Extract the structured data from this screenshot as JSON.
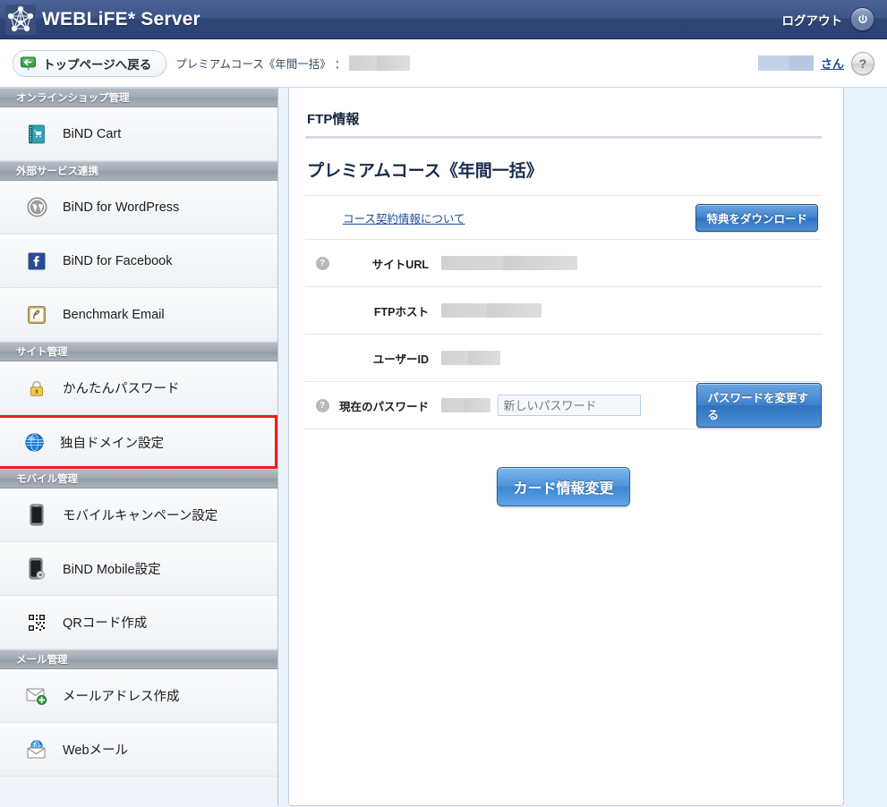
{
  "header": {
    "logo_icon": "network-nodes-logo",
    "title": "WEBLiFE* Server",
    "logout_label": "ログアウト",
    "power_icon": "power-icon"
  },
  "toolbar": {
    "back_icon": "back-arrow-sign-icon",
    "back_label": "トップページへ戻る",
    "breadcrumb_course": "プレミアムコース《年間一括》",
    "breadcrumb_separator": "：",
    "breadcrumb_value_redacted": "",
    "user_name_redacted": "",
    "user_suffix": "さん",
    "help_label": "?"
  },
  "sidebar": {
    "groups": [
      {
        "title": "オンラインショップ管理",
        "items": [
          {
            "label": "BiND Cart",
            "icon": "cart-book-icon",
            "selected": false
          }
        ]
      },
      {
        "title": "外部サービス連携",
        "items": [
          {
            "label": "BiND for WordPress",
            "icon": "wordpress-icon",
            "selected": false
          },
          {
            "label": "BiND for Facebook",
            "icon": "facebook-icon",
            "selected": false
          },
          {
            "label": "Benchmark Email",
            "icon": "benchmark-email-icon",
            "selected": false
          }
        ]
      },
      {
        "title": "サイト管理",
        "items": [
          {
            "label": "かんたんパスワード",
            "icon": "lock-icon",
            "selected": false
          },
          {
            "label": "独自ドメイン設定",
            "icon": "globe-icon",
            "selected": true
          }
        ]
      },
      {
        "title": "モバイル管理",
        "items": [
          {
            "label": "モバイルキャンペーン設定",
            "icon": "mobile-phone-icon",
            "selected": false
          },
          {
            "label": "BiND Mobile設定",
            "icon": "mobile-gear-icon",
            "selected": false
          },
          {
            "label": "QRコード作成",
            "icon": "qr-code-icon",
            "selected": false
          }
        ]
      },
      {
        "title": "メール管理",
        "items": [
          {
            "label": "メールアドレス作成",
            "icon": "mail-add-icon",
            "selected": false
          },
          {
            "label": "Webメール",
            "icon": "webmail-globe-icon",
            "selected": false
          }
        ]
      }
    ]
  },
  "main": {
    "page_title": "FTP情報",
    "course_heading": "プレミアムコース《年間一括》",
    "contract_link": "コース契約情報について",
    "download_button": "特典をダウンロード",
    "rows": [
      {
        "label": "サイトURL",
        "has_hint": true,
        "value_redacted": "",
        "redact_width": 150
      },
      {
        "label": "FTPホスト",
        "has_hint": false,
        "value_redacted": "",
        "redact_width": 110
      },
      {
        "label": "ユーザーID",
        "has_hint": false,
        "value_redacted": "",
        "redact_width": 65
      }
    ],
    "password_row": {
      "label": "現在のパスワード",
      "has_hint": true,
      "current_redact_width": 60,
      "new_password_placeholder": "新しいパスワード",
      "new_password_value": "",
      "change_button": "パスワードを変更する"
    },
    "card_button": "カード情報変更"
  },
  "colors": {
    "header_blue": "#2f4677",
    "accent_blue": "#3d81cc",
    "link_blue": "#1f4b9b",
    "selection_red": "#ee1c1c",
    "page_background": "#eaf2fb",
    "sidebar_group": "#9fa8b2"
  }
}
